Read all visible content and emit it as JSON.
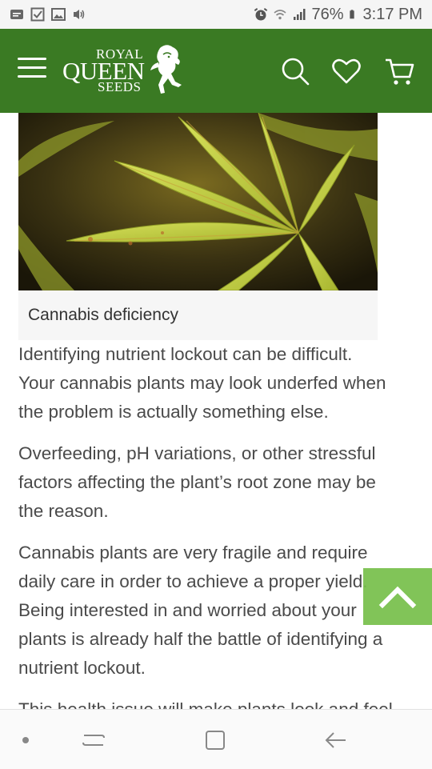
{
  "status_bar": {
    "battery": "76%",
    "time": "3:17 PM",
    "icons": [
      "sms-icon",
      "checkbox-icon",
      "gallery-icon",
      "volume-icon",
      "alarm-icon",
      "wifi-icon",
      "signal-icon",
      "battery-icon"
    ]
  },
  "header": {
    "logo": {
      "top": "ROYAL",
      "middle": "QUEEN",
      "bottom": "SEEDS"
    },
    "icons": [
      "menu-icon",
      "search-icon",
      "heart-icon",
      "cart-icon"
    ],
    "background_color": "#3a7a23"
  },
  "article": {
    "image_caption": "Cannabis deficiency",
    "paragraphs": [
      [
        "Identifying nutrient lockout can be difficult.",
        "Your cannabis plants may look underfed when",
        "the problem is actually something else."
      ],
      [
        "Overfeeding, pH variations, or other stressful",
        "factors affecting the plant’s root zone may be",
        "the reason."
      ],
      [
        "Cannabis plants are very fragile and require",
        "daily care in order to achieve a proper yield.",
        "Being interested in and worried about your",
        "plants is already half the battle of identifying a",
        "nutrient lockout."
      ],
      [
        "This health issue will make plants look and feel"
      ]
    ]
  },
  "scroll_to_top": {
    "icon": "chevron-up-icon",
    "color": "#77c04a"
  },
  "nav_bar": {
    "icons": [
      "dot-icon",
      "recent-apps-icon",
      "home-icon",
      "back-icon"
    ]
  }
}
